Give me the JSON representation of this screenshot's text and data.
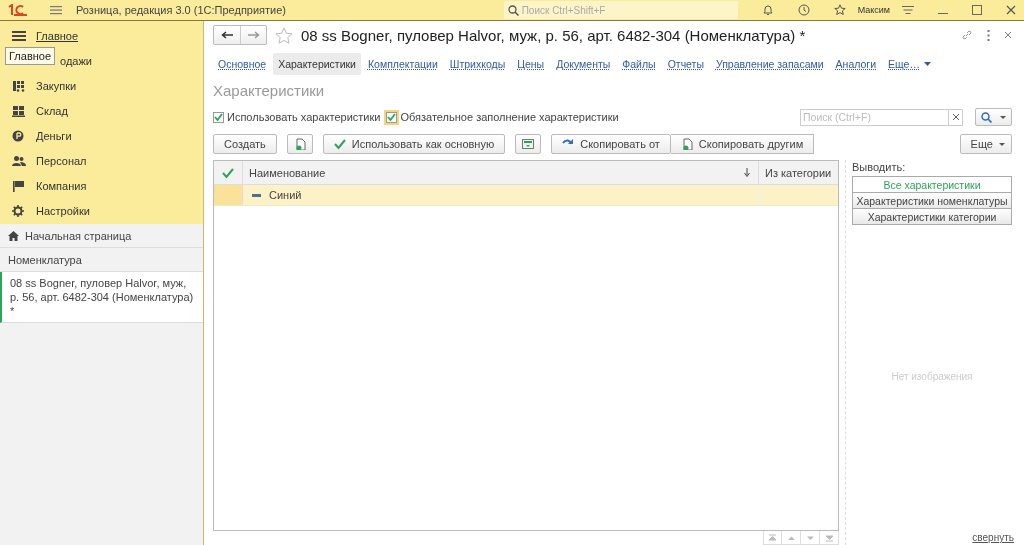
{
  "window": {
    "title": "Розница, редакция 3.0  (1С:Предприятие)",
    "search_placeholder": "Поиск Ctrl+Shift+F",
    "user": "Максим"
  },
  "sidebar": {
    "items": [
      {
        "label": "Главное",
        "selected": true
      },
      {
        "label": "одажи",
        "selected": false
      },
      {
        "label": "Закупки",
        "selected": false
      },
      {
        "label": "Склад",
        "selected": false
      },
      {
        "label": "Деньги",
        "selected": false
      },
      {
        "label": "Персонал",
        "selected": false
      },
      {
        "label": "Компания",
        "selected": false
      },
      {
        "label": "Настройки",
        "selected": false
      }
    ],
    "tooltip": "Главное",
    "home": "Начальная страница",
    "section": "Номенклатура",
    "open_windows": [
      {
        "label": "08 ss Bogner, пуловер Halvor, муж, р. 56, арт. 6482-304 (Номенклатура) *",
        "selected": true
      }
    ]
  },
  "form": {
    "title": "08 ss Bogner, пуловер Halvor, муж, р. 56, арт. 6482-304 (Номенклатура) *",
    "tabs": [
      {
        "label": "Основное",
        "selected": false
      },
      {
        "label": "Характеристики",
        "selected": true
      },
      {
        "label": "Комплектации",
        "selected": false
      },
      {
        "label": "Штрихкоды",
        "selected": false
      },
      {
        "label": "Цены",
        "selected": false
      },
      {
        "label": "Документы",
        "selected": false
      },
      {
        "label": "Файлы",
        "selected": false
      },
      {
        "label": "Отчеты",
        "selected": false
      },
      {
        "label": "Управление запасами",
        "selected": false
      },
      {
        "label": "Аналоги",
        "selected": false
      },
      {
        "label": "Еще…",
        "selected": false
      }
    ],
    "section_title": "Характеристики",
    "checkboxes": [
      {
        "label": "Использовать характеристики",
        "checked": true,
        "focused": false
      },
      {
        "label": "Обязательное заполнение характеристики",
        "checked": true,
        "focused": true
      }
    ],
    "search_placeholder": "Поиск (Ctrl+F)",
    "toolbar": [
      {
        "kind": "text",
        "label": "Создать"
      },
      {
        "kind": "copy"
      },
      {
        "kind": "accept",
        "label": "Использовать как основную"
      },
      {
        "kind": "card"
      },
      {
        "kind": "arrow",
        "label": "Скопировать от"
      },
      {
        "kind": "share",
        "label": "Скопировать другим"
      }
    ],
    "more": "Еще",
    "table": {
      "columns": [
        {
          "label": "Наименование",
          "sorted": true
        },
        {
          "label": "Из категории",
          "sorted": false
        }
      ],
      "rows": [
        {
          "name": "Синий",
          "selected": true
        }
      ]
    },
    "output_label": "Выводить:",
    "filters": [
      {
        "label": "Все характеристики",
        "selected": true
      },
      {
        "label": "Характеристики номенклатуры",
        "selected": false
      },
      {
        "label": "Характеристики категории",
        "selected": false
      }
    ],
    "no_image": "Нет изображения",
    "collapse": "свернуть"
  }
}
